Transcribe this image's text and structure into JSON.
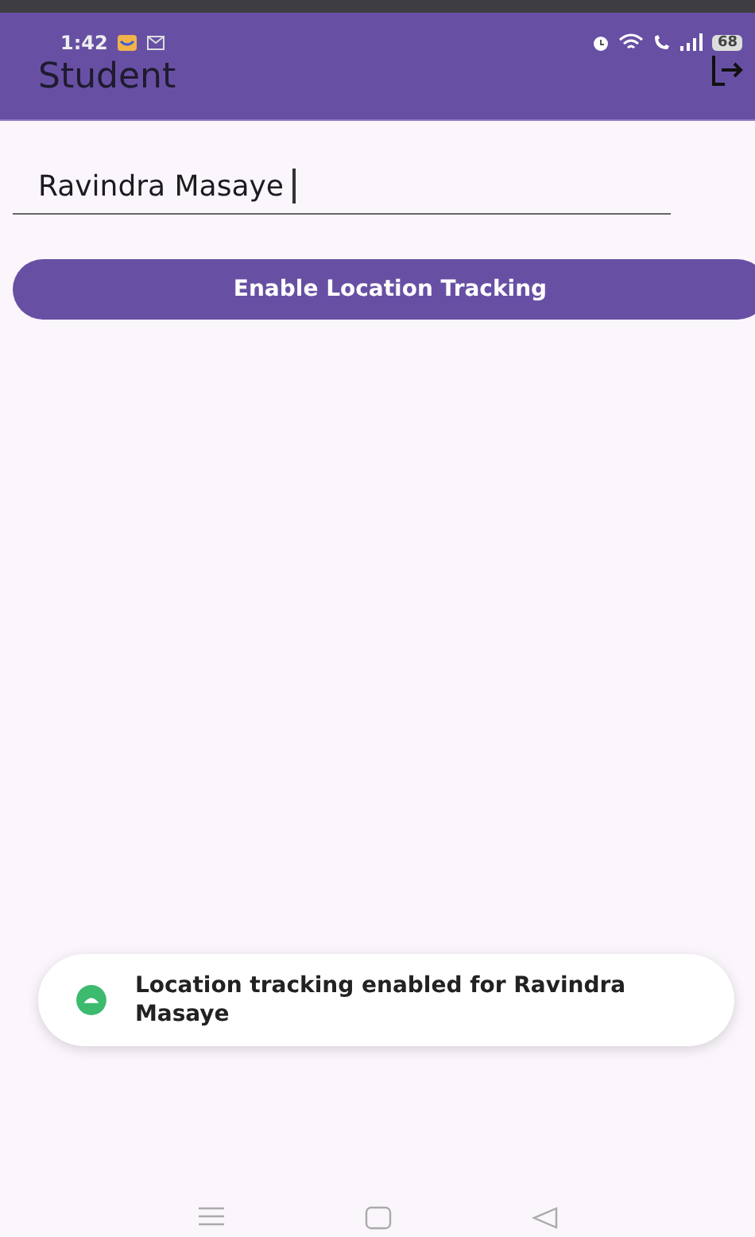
{
  "status_bar": {
    "time": "1:42",
    "battery": "68"
  },
  "app_bar": {
    "title": "Student"
  },
  "name_field": {
    "value": "Ravindra Masaye"
  },
  "button": {
    "label": "Enable Location Tracking"
  },
  "toast": {
    "message": "Location tracking enabled for Ravindra Masaye"
  }
}
